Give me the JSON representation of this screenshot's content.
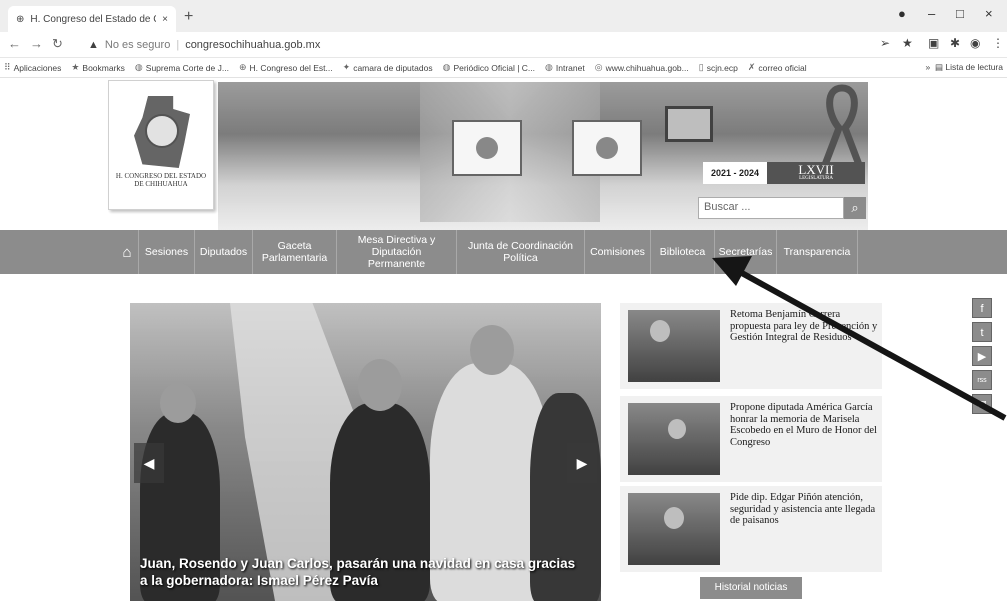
{
  "browser": {
    "tab_title": "H. Congreso del Estado de Chihu",
    "tab_close": "×",
    "new_tab": "+",
    "not_secure": "No es seguro",
    "url": "congresochihuahua.gob.mx",
    "window_min": "–",
    "window_max": "□",
    "window_close": "×"
  },
  "bookmarks": {
    "items": [
      {
        "label": "Aplicaciones",
        "icon": "apps-grid-icon"
      },
      {
        "label": "Bookmarks",
        "icon": "star-icon"
      },
      {
        "label": "Suprema Corte de J...",
        "icon": "globe-icon"
      },
      {
        "label": "H. Congreso del Est...",
        "icon": "congress-icon"
      },
      {
        "label": "camara de diputados",
        "icon": "eagle-icon"
      },
      {
        "label": "Periódico Oficial | C...",
        "icon": "globe-icon"
      },
      {
        "label": "Intranet",
        "icon": "globe-icon"
      },
      {
        "label": "www.chihuahua.gob...",
        "icon": "state-icon"
      },
      {
        "label": "scjn.ecp",
        "icon": "file-icon"
      },
      {
        "label": "correo oficial",
        "icon": "x-icon"
      }
    ],
    "reading_list": "Lista de lectura",
    "more": "»"
  },
  "header": {
    "logo_text_line1": "H. CONGRESO DEL ESTADO",
    "logo_text_line2": "DE CHIHUAHUA",
    "legislature_period": "2021 - 2024",
    "legislature_number": "LXVII",
    "legislature_sub": "LEGISLATURA",
    "search_placeholder": "Buscar ..."
  },
  "nav": {
    "items": [
      "Sesiones",
      "Diputados",
      "Gaceta Parlamentaria",
      "Mesa Directiva y Diputación Permanente",
      "Junta de Coordinación Política",
      "Comisiones",
      "Biblioteca",
      "Secretarías",
      "Transparencia"
    ]
  },
  "slider": {
    "caption": "Juan, Rosendo y Juan Carlos, pasarán una navidad en casa gracias a la gobernadora: Ismael Pérez Pavía"
  },
  "news": [
    {
      "title": "Retoma Benjamín Carrera propuesta para ley de Prevención y Gestión Integral de Residuos"
    },
    {
      "title": "Propone diputada América García honrar la memoria de Marisela Escobedo en el Muro de Honor del Congreso"
    },
    {
      "title": "Pide dip. Edgar Piñón atención, seguridad y asistencia ante llegada de paisanos"
    }
  ],
  "history_button": "Historial noticias",
  "social": [
    "f",
    "t",
    "▶",
    "rss",
    "✉"
  ],
  "colors": {
    "nav_bg": "#8b8b8b",
    "arrow": "#1a1a1a"
  }
}
